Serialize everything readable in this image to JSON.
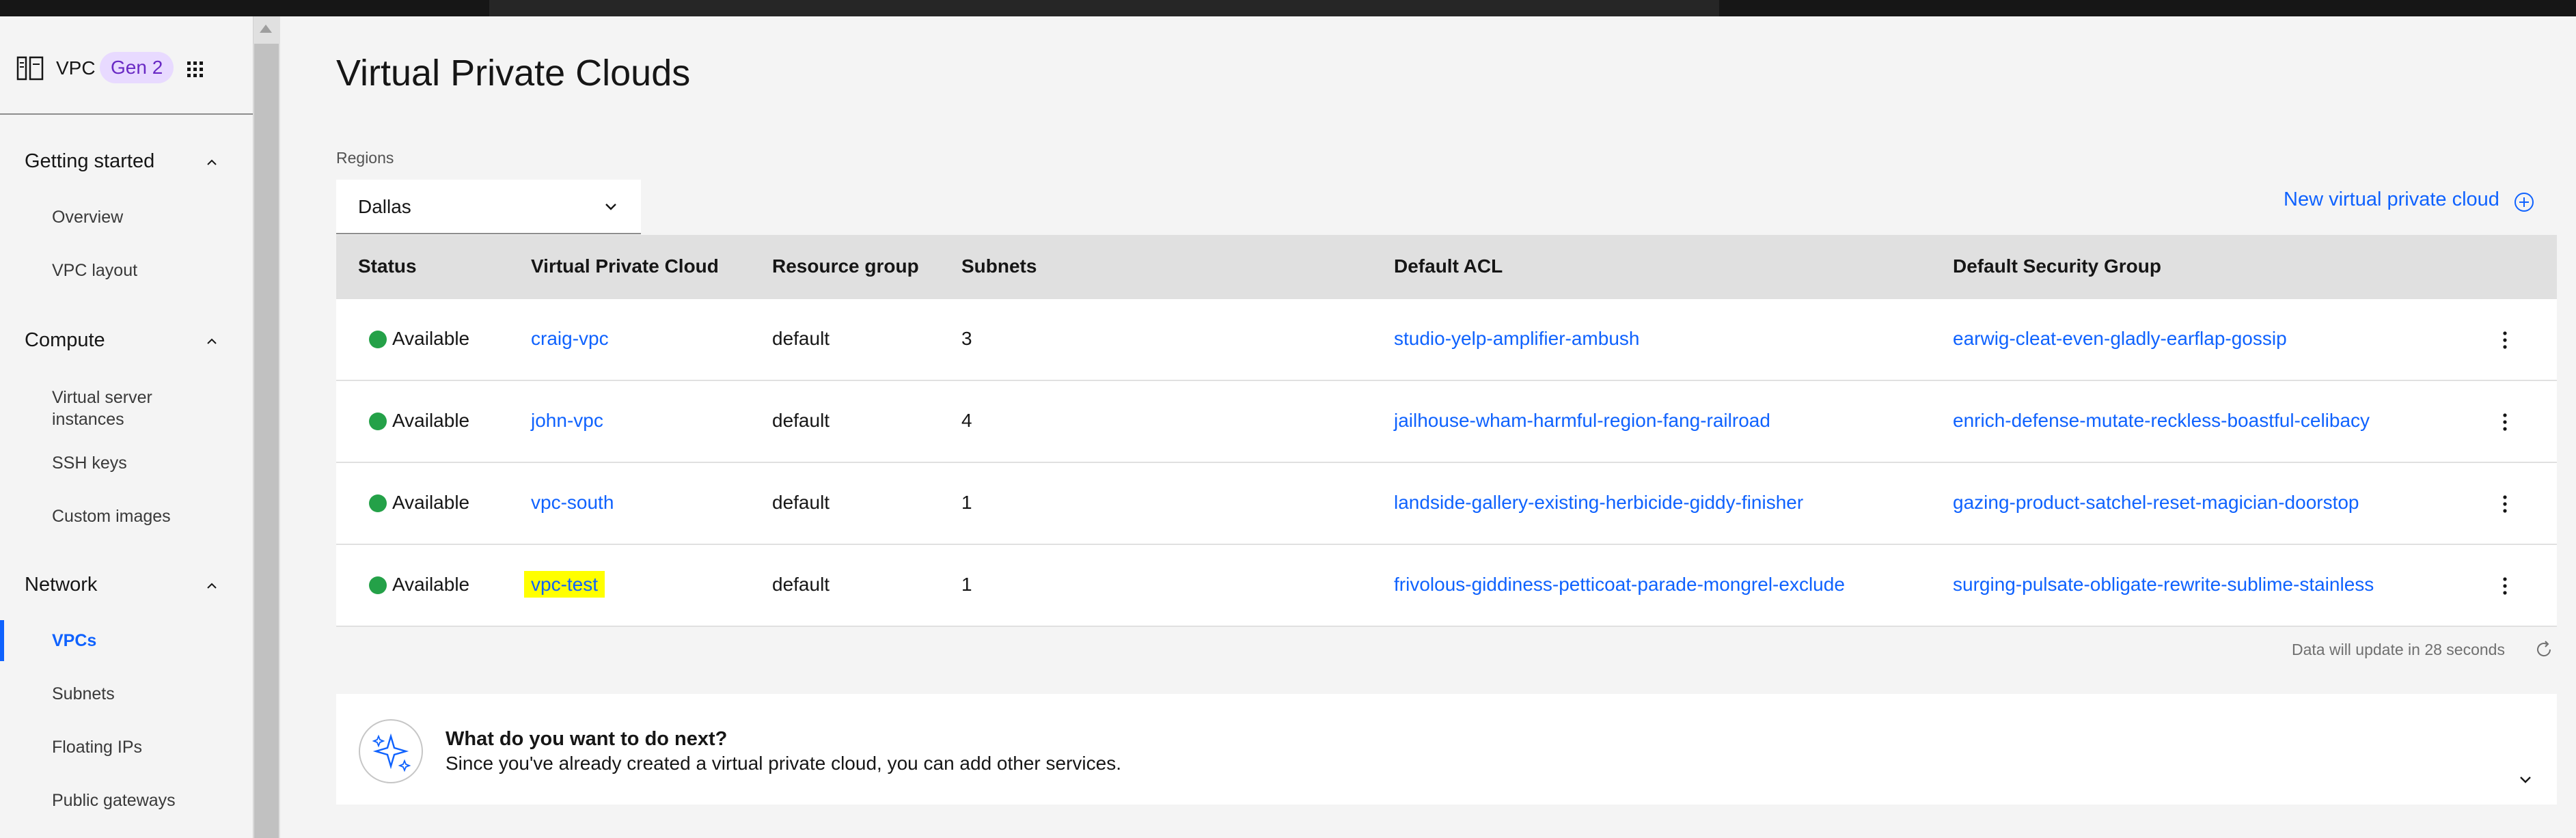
{
  "sidebar": {
    "product_name": "VPC",
    "badge": "Gen 2",
    "sections": [
      {
        "label": "Getting started",
        "items": [
          "Overview",
          "VPC layout"
        ]
      },
      {
        "label": "Compute",
        "items": [
          "Virtual server instances",
          "SSH keys",
          "Custom images"
        ]
      },
      {
        "label": "Network",
        "items": [
          "VPCs",
          "Subnets",
          "Floating IPs",
          "Public gateways"
        ]
      }
    ],
    "active_item": "VPCs"
  },
  "main": {
    "title": "Virtual Private Clouds",
    "regions_label": "Regions",
    "region_value": "Dallas",
    "new_vpc_label": "New virtual private cloud",
    "table": {
      "headers": [
        "Status",
        "Virtual Private Cloud",
        "Resource group",
        "Subnets",
        "Default ACL",
        "Default Security Group"
      ],
      "rows": [
        {
          "status": "Available",
          "vpc": "craig-vpc",
          "resource_group": "default",
          "subnets": "3",
          "acl": "studio-yelp-amplifier-ambush",
          "security_group": "earwig-cleat-even-gladly-earflap-gossip"
        },
        {
          "status": "Available",
          "vpc": "john-vpc",
          "resource_group": "default",
          "subnets": "4",
          "acl": "jailhouse-wham-harmful-region-fang-railroad",
          "security_group": "enrich-defense-mutate-reckless-boastful-celibacy"
        },
        {
          "status": "Available",
          "vpc": "vpc-south",
          "resource_group": "default",
          "subnets": "1",
          "acl": "landside-gallery-existing-herbicide-giddy-finisher",
          "security_group": "gazing-product-satchel-reset-magician-doorstop"
        },
        {
          "status": "Available",
          "vpc": "vpc-test",
          "resource_group": "default",
          "subnets": "1",
          "acl": "frivolous-giddiness-petticoat-parade-mongrel-exclude",
          "security_group": "surging-pulsate-obligate-rewrite-sublime-stainless"
        }
      ]
    },
    "data_update": "Data will update in 28 seconds",
    "next_panel": {
      "title": "What do you want to do next?",
      "description": "Since you've already created a virtual private cloud, you can add other services."
    }
  },
  "colors": {
    "link": "#0f62fe",
    "status_available": "#24a148",
    "highlight": "#ffff00",
    "badge_bg": "#e8daff",
    "badge_text": "#6929c4"
  },
  "icons": [
    "vpc-product-icon",
    "app-switcher-icon",
    "chevron-up-icon",
    "chevron-down-icon",
    "add-circle-icon",
    "overflow-menu-icon",
    "refresh-icon",
    "sparkle-icon"
  ]
}
